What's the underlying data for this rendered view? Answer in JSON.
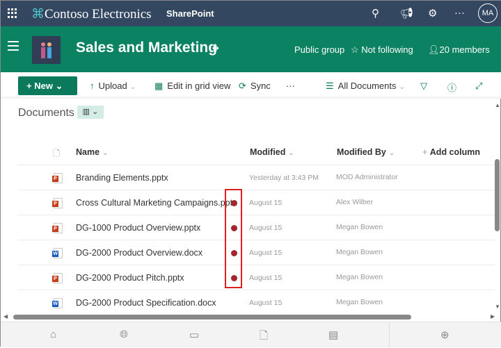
{
  "topbar": {
    "brand": "Contoso Electronics",
    "app": "SharePoint",
    "avatar": "MA",
    "icons": [
      "search-icon",
      "megaphone-icon",
      "settings-icon",
      "more-icon"
    ]
  },
  "header": {
    "site_title": "Sales and Marketing",
    "privacy": "Public group",
    "follow": "Not following",
    "members": "20 members"
  },
  "commandbar": {
    "new": "New",
    "upload": "Upload",
    "grid": "Edit in grid view",
    "sync": "Sync",
    "more": "···",
    "view": "All Documents"
  },
  "library": {
    "title": "Documents"
  },
  "columns": {
    "name": "Name",
    "modified": "Modified",
    "modified_by": "Modified By",
    "add": "Add column"
  },
  "files": [
    {
      "name": "Branding Elements.pptx",
      "type": "pptx",
      "modified": "Yesterday at 3:43 PM",
      "by": "MOD Administrator",
      "alert": false
    },
    {
      "name": "Cross Cultural Marketing Campaigns.pptx",
      "type": "pptx",
      "modified": "August 15",
      "by": "Alex Wilber",
      "alert": true
    },
    {
      "name": "DG-1000 Product Overview.pptx",
      "type": "pptx",
      "modified": "August 15",
      "by": "Megan Bowen",
      "alert": true
    },
    {
      "name": "DG-2000 Product Overview.docx",
      "type": "docx",
      "modified": "August 15",
      "by": "Megan Bowen",
      "alert": true
    },
    {
      "name": "DG-2000 Product Pitch.pptx",
      "type": "pptx",
      "modified": "August 15",
      "by": "Megan Bowen",
      "alert": true
    },
    {
      "name": "DG-2000 Product Specification.docx",
      "type": "docx",
      "modified": "August 15",
      "by": "Megan Bowen",
      "alert": false
    }
  ],
  "colors": {
    "suitebar": "#334760",
    "header": "#0b8262",
    "alert": "#a4262c",
    "highlight": "#e01e1e"
  }
}
